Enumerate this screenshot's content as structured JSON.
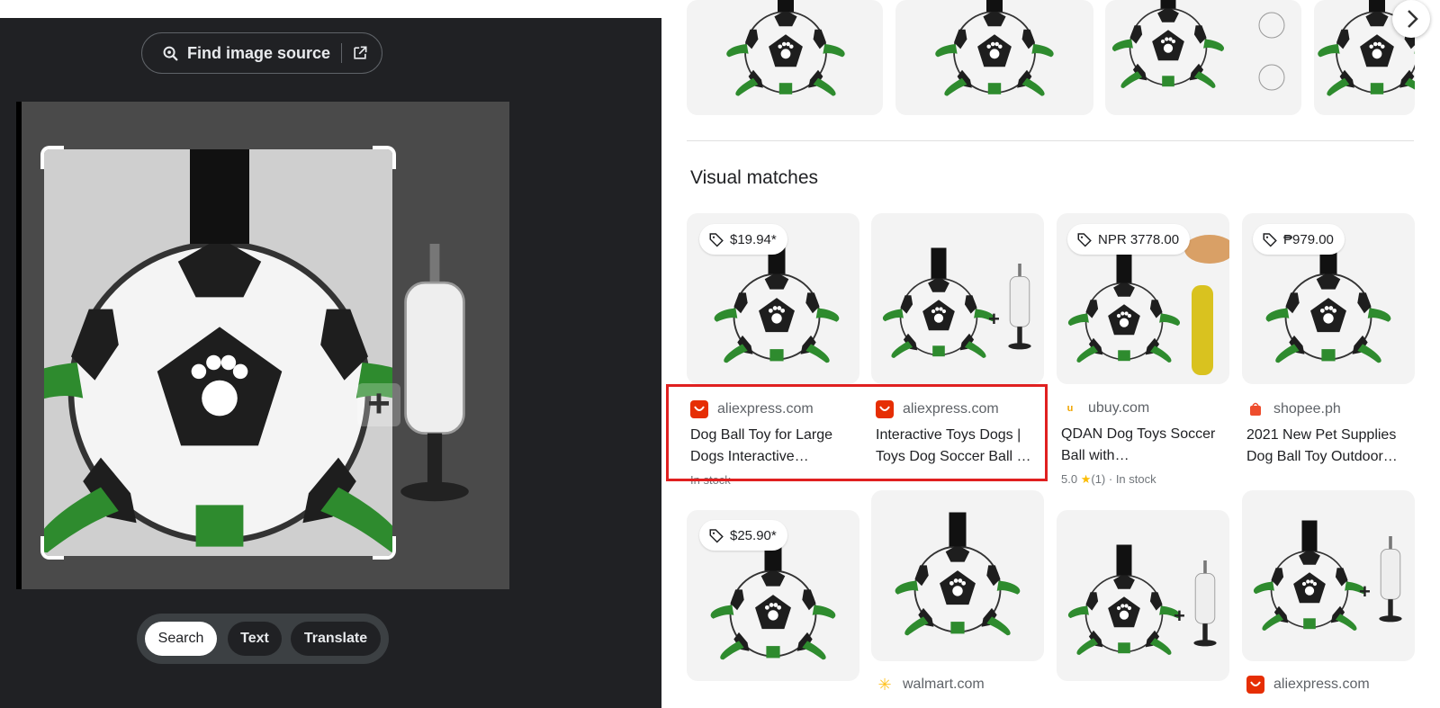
{
  "lens_panel": {
    "find_source_label": "Find image source",
    "modes": [
      {
        "label": "Search",
        "active": true
      },
      {
        "label": "Text",
        "active": false
      },
      {
        "label": "Translate",
        "active": false
      }
    ]
  },
  "results": {
    "section_title": "Visual matches",
    "cards": [
      {
        "price": "$19.94*",
        "site": "aliexpress.com",
        "title": "Dog Ball Toy for Large Dogs Interactive…",
        "meta": "In stock"
      },
      {
        "price": "",
        "site": "aliexpress.com",
        "title": "Interactive Toys Dogs | Toys Dog Soccer Ball …",
        "meta": ""
      },
      {
        "price": "NPR 3778.00",
        "site": "ubuy.com",
        "title": "QDAN Dog Toys Soccer Ball with…",
        "rating": "5.0",
        "review_count": "(1)",
        "meta": "In stock"
      },
      {
        "price": "₱979.00",
        "site": "shopee.ph",
        "title": "2021 New Pet Supplies Dog Ball Toy Outdoor…",
        "meta": ""
      },
      {
        "price": "$25.90*",
        "site": "",
        "title": "",
        "meta": ""
      },
      {
        "price": "",
        "site": "walmart.com",
        "title": "",
        "meta": ""
      },
      {
        "price": "",
        "site": "",
        "title": "",
        "meta": ""
      },
      {
        "price": "",
        "site": "aliexpress.com",
        "title": "",
        "meta": ""
      }
    ]
  },
  "colors": {
    "panel_bg": "#202124",
    "highlight_border": "#e02020",
    "ball_green": "#2e8b2e",
    "aliexpress_red": "#e62e04",
    "walmart_yellow": "#ffc220",
    "shopee_orange": "#ee4d2d"
  },
  "icons": [
    "lens-search-icon",
    "external-link-icon",
    "price-tag-icon",
    "plus-icon",
    "aliexpress-favicon",
    "ubuy-favicon",
    "shopee-favicon",
    "walmart-favicon",
    "star-icon",
    "chevron-right-icon"
  ]
}
